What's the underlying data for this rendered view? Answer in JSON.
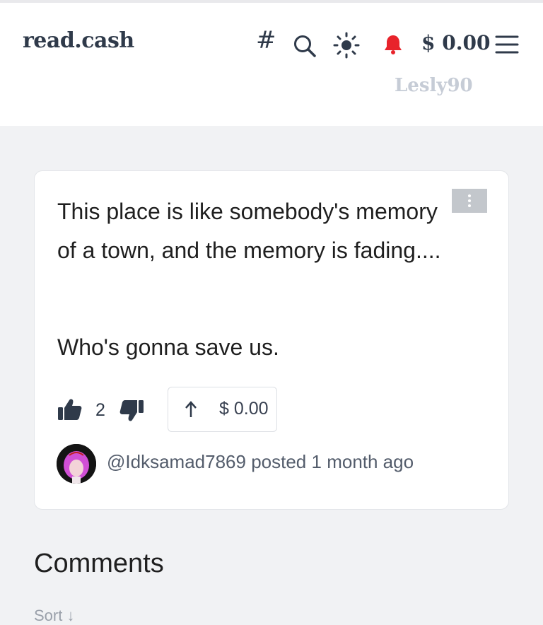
{
  "header": {
    "logo": "read.cash",
    "balance": "$ 0.00",
    "username": "Lesly90",
    "icons": [
      "hash-icon",
      "search-icon",
      "sun-icon",
      "bell-icon",
      "menu-icon"
    ],
    "colors": {
      "text": "#2f3a4a",
      "bell": "#e8232b",
      "username": "#c6ccd6"
    }
  },
  "post": {
    "paragraph1": "This place is like somebody's memory of a town, and the memory is fading....",
    "paragraph2": "Who's gonna save us.",
    "likes": "2",
    "tip_amount": "$ 0.00",
    "author": "@Idksamad7869",
    "posted_text": "posted",
    "time": "1 month ago"
  },
  "comments": {
    "title": "Comments",
    "sort_label": "Sort ↓"
  }
}
